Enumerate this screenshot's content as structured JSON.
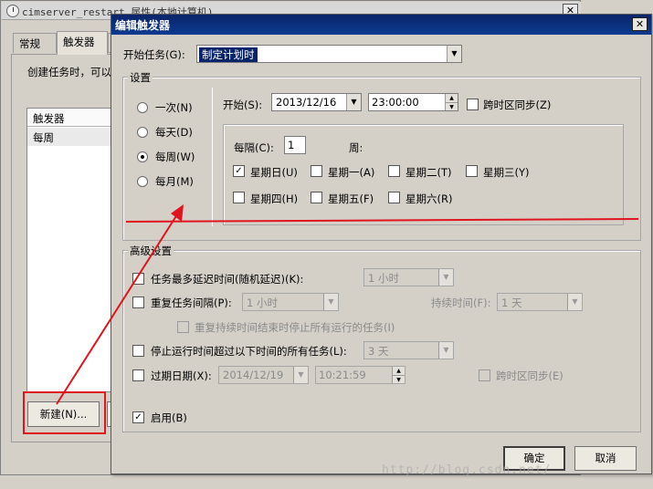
{
  "background_window": {
    "title": "cimserver_restart 属性(本地计算机)",
    "close_glyph": "✕",
    "tabs": [
      {
        "label": "常规"
      },
      {
        "label": "触发器"
      }
    ],
    "description": "创建任务时，可以",
    "trigger_list": {
      "header": "触发器",
      "rows": [
        "每周"
      ]
    },
    "new_button": "新建(N)..."
  },
  "dialog": {
    "title": "编辑触发器",
    "close_glyph": "✕",
    "begin_task": {
      "label": "开始任务(G):",
      "value": "制定计划时"
    },
    "settings": {
      "group_label": "设置",
      "schedule_options": [
        {
          "label": "一次(N)",
          "checked": false
        },
        {
          "label": "每天(D)",
          "checked": false
        },
        {
          "label": "每周(W)",
          "checked": true
        },
        {
          "label": "每月(M)",
          "checked": false
        }
      ],
      "start_label": "开始(S):",
      "start_date": "2013/12/16",
      "start_time": "23:00:00",
      "sync_timezone": {
        "label": "跨时区同步(Z)",
        "checked": false
      },
      "recur_label": "每隔(C):",
      "recur_value": "1",
      "recur_unit": "周:",
      "weekdays": [
        {
          "label": "星期日(U)",
          "checked": true
        },
        {
          "label": "星期一(A)",
          "checked": false
        },
        {
          "label": "星期二(T)",
          "checked": false
        },
        {
          "label": "星期三(Y)",
          "checked": false
        },
        {
          "label": "星期四(H)",
          "checked": false
        },
        {
          "label": "星期五(F)",
          "checked": false
        },
        {
          "label": "星期六(R)",
          "checked": false
        }
      ]
    },
    "advanced": {
      "group_label": "高级设置",
      "delay": {
        "label": "任务最多延迟时间(随机延迟)(K):",
        "value": "1 小时",
        "checked": false
      },
      "repeat": {
        "label": "重复任务间隔(P):",
        "value": "1 小时",
        "checked": false,
        "duration_label": "持续时间(F):",
        "duration_value": "1 天"
      },
      "stop_running": {
        "label": "重复持续时间结束时停止所有运行的任务(I)",
        "checked": false
      },
      "stop_if_longer": {
        "label": "停止运行时间超过以下时间的所有任务(L):",
        "value": "3 天",
        "checked": false
      },
      "expire": {
        "label": "过期日期(X):",
        "date": "2014/12/19",
        "time": "10:21:59",
        "checked": false,
        "sync_label": "跨时区同步(E)"
      },
      "enabled": {
        "label": "启用(B)",
        "checked": true
      }
    },
    "ok_button": "确定",
    "cancel_button": "取消"
  },
  "annotation_colors": {
    "red": "#e0141e"
  },
  "icons": {
    "dropdown_arrow": "▼",
    "checkmark": "✓",
    "spin_up": "▲",
    "spin_down": "▼"
  },
  "watermark": "http://blog.csdn.net/"
}
